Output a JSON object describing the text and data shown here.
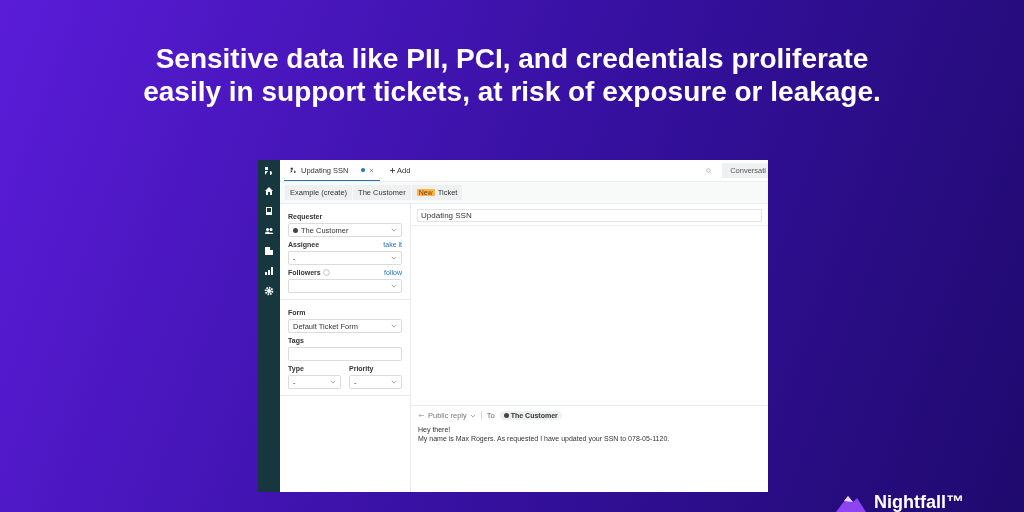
{
  "headline": [
    "Sensitive data like PII, PCI, and credentials proliferate",
    "easily in support tickets, at risk of exposure or leakage."
  ],
  "app": {
    "top_tabs": [
      {
        "label": "Updating SSN",
        "selected": true,
        "unsaved": true
      }
    ],
    "add_label": "Add",
    "conversations_label": "Conversati",
    "breadcrumbs": [
      {
        "label": "Example (create)"
      },
      {
        "label": "The Customer"
      },
      {
        "badge": "New",
        "label": "Ticket"
      }
    ],
    "requester": {
      "label": "Requester",
      "value": "The Customer"
    },
    "assignee": {
      "label": "Assignee",
      "link": "take it",
      "value": "-"
    },
    "followers": {
      "label": "Followers",
      "link": "follow"
    },
    "form": {
      "label": "Form",
      "value": "Default Ticket Form"
    },
    "tags": {
      "label": "Tags"
    },
    "type": {
      "label": "Type",
      "value": "-"
    },
    "priority": {
      "label": "Priority",
      "value": "-"
    },
    "subject": "Updating SSN",
    "reply": {
      "mode": "Public reply",
      "to_label": "To",
      "recipient": "The Customer",
      "body": [
        "Hey there!",
        "My name is Max Rogers. As requested I have updated your SSN to 078-05-1120."
      ]
    }
  },
  "brand": "Nightfall™"
}
